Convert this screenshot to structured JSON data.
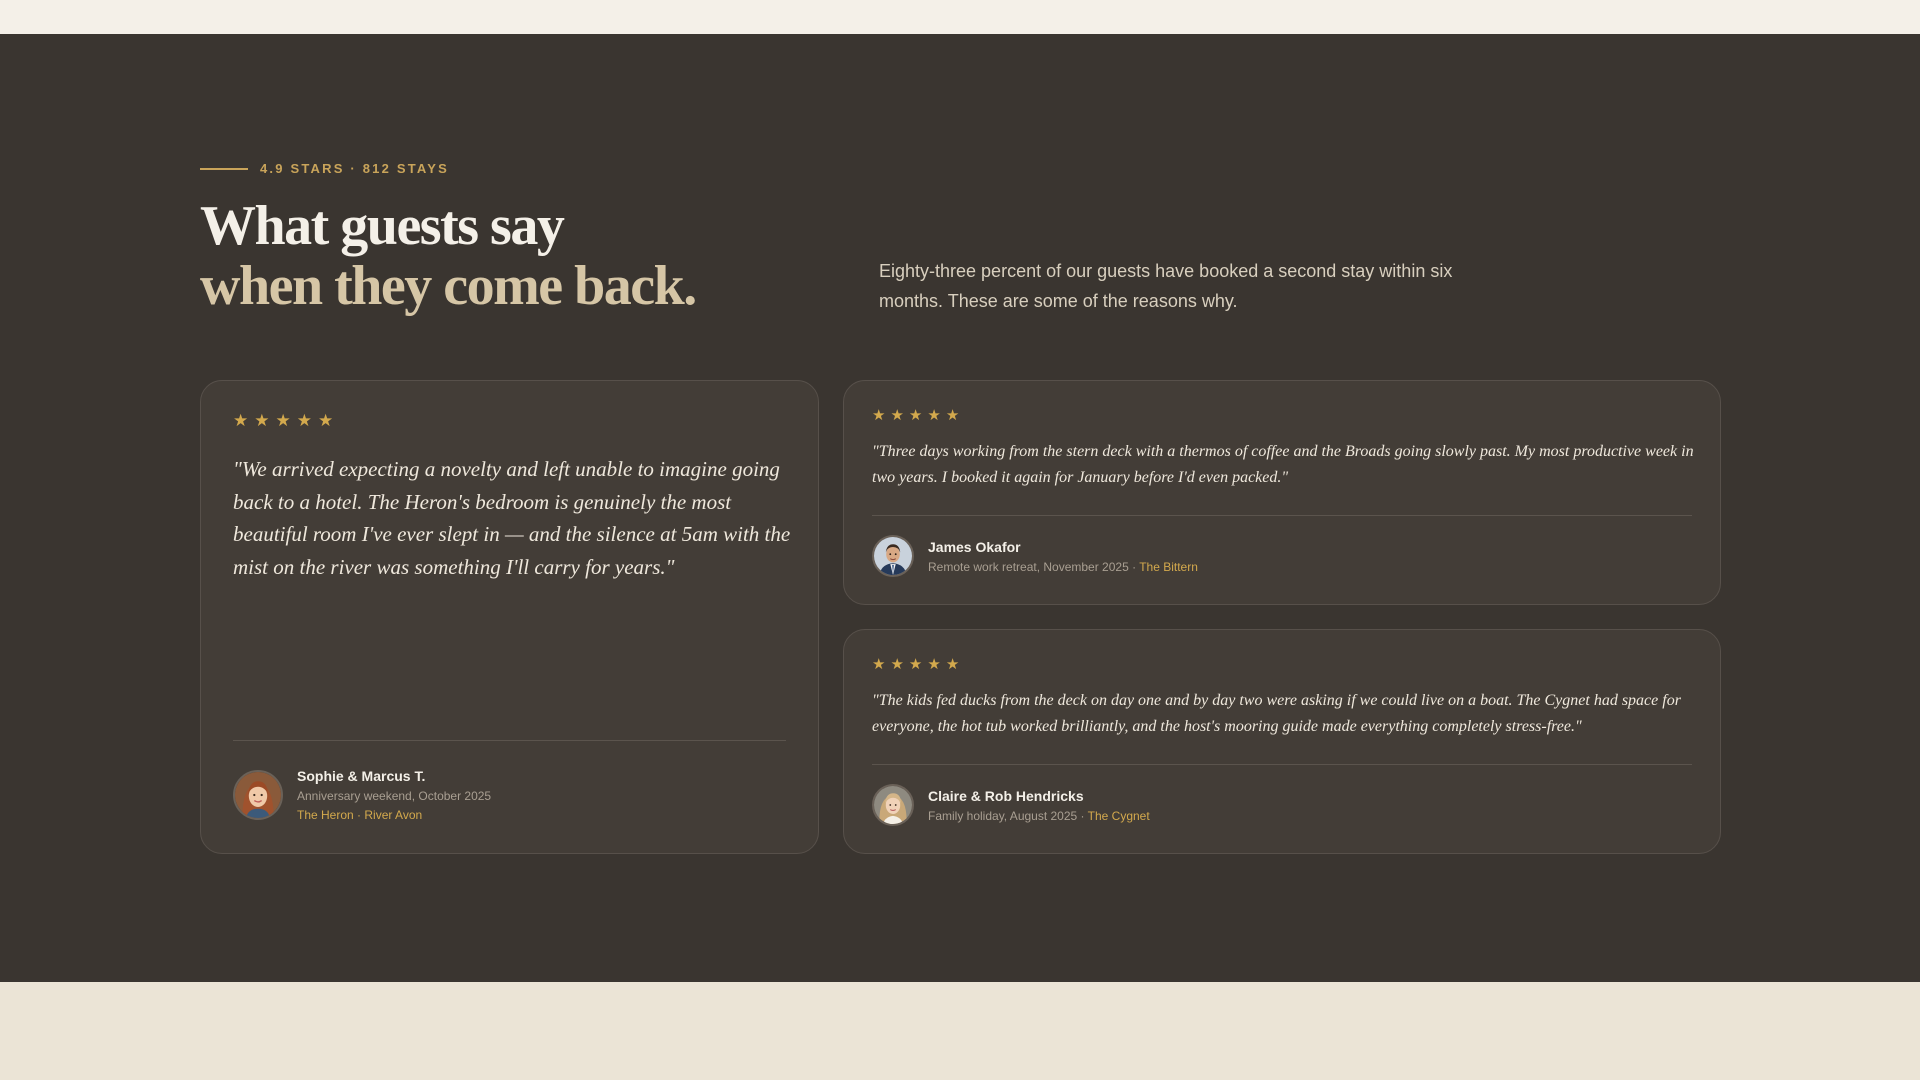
{
  "header": {
    "eyebrow": "4.9 STARS · 812 STAYS",
    "headline_line1": "What guests say",
    "headline_line2": "when they come back.",
    "intro": "Eighty-three percent of our guests have booked a second stay within six months. These are some of the reasons why."
  },
  "colors": {
    "section_bg": "#3a3530",
    "card_bg": "#433d37",
    "accent_gold": "#d3a94d",
    "headline_light": "#f4f0e8",
    "headline_muted": "#d6c6a6"
  },
  "testimonials": [
    {
      "stars": 5,
      "quote": "\"We arrived expecting a novelty and left unable to imagine going back to a hotel. The Heron's bedroom is genuinely the most beautiful room I've ever slept in — and the silence at 5am with the mist on the river was something I'll carry for years.\"",
      "name": "Sophie & Marcus T.",
      "meta": "Anniversary weekend, October 2025",
      "boat": "The Heron · River Avon",
      "avatar_icon": "woman-avatar"
    },
    {
      "stars": 5,
      "quote": "\"Three days working from the stern deck with a thermos of coffee and the Broads going slowly past. My most productive week in two years. I booked it again for January before I'd even packed.\"",
      "name": "James Okafor",
      "meta": "Remote work retreat, November 2025 · ",
      "boat": "The Bittern",
      "avatar_icon": "man-avatar"
    },
    {
      "stars": 5,
      "quote": "\"The kids fed ducks from the deck on day one and by day two were asking if we could live on a boat. The Cygnet had space for everyone, the hot tub worked brilliantly, and the host's mooring guide made everything completely stress-free.\"",
      "name": "Claire & Rob Hendricks",
      "meta": "Family holiday, August 2025 · ",
      "boat": "The Cygnet",
      "avatar_icon": "woman-blonde-avatar"
    }
  ]
}
